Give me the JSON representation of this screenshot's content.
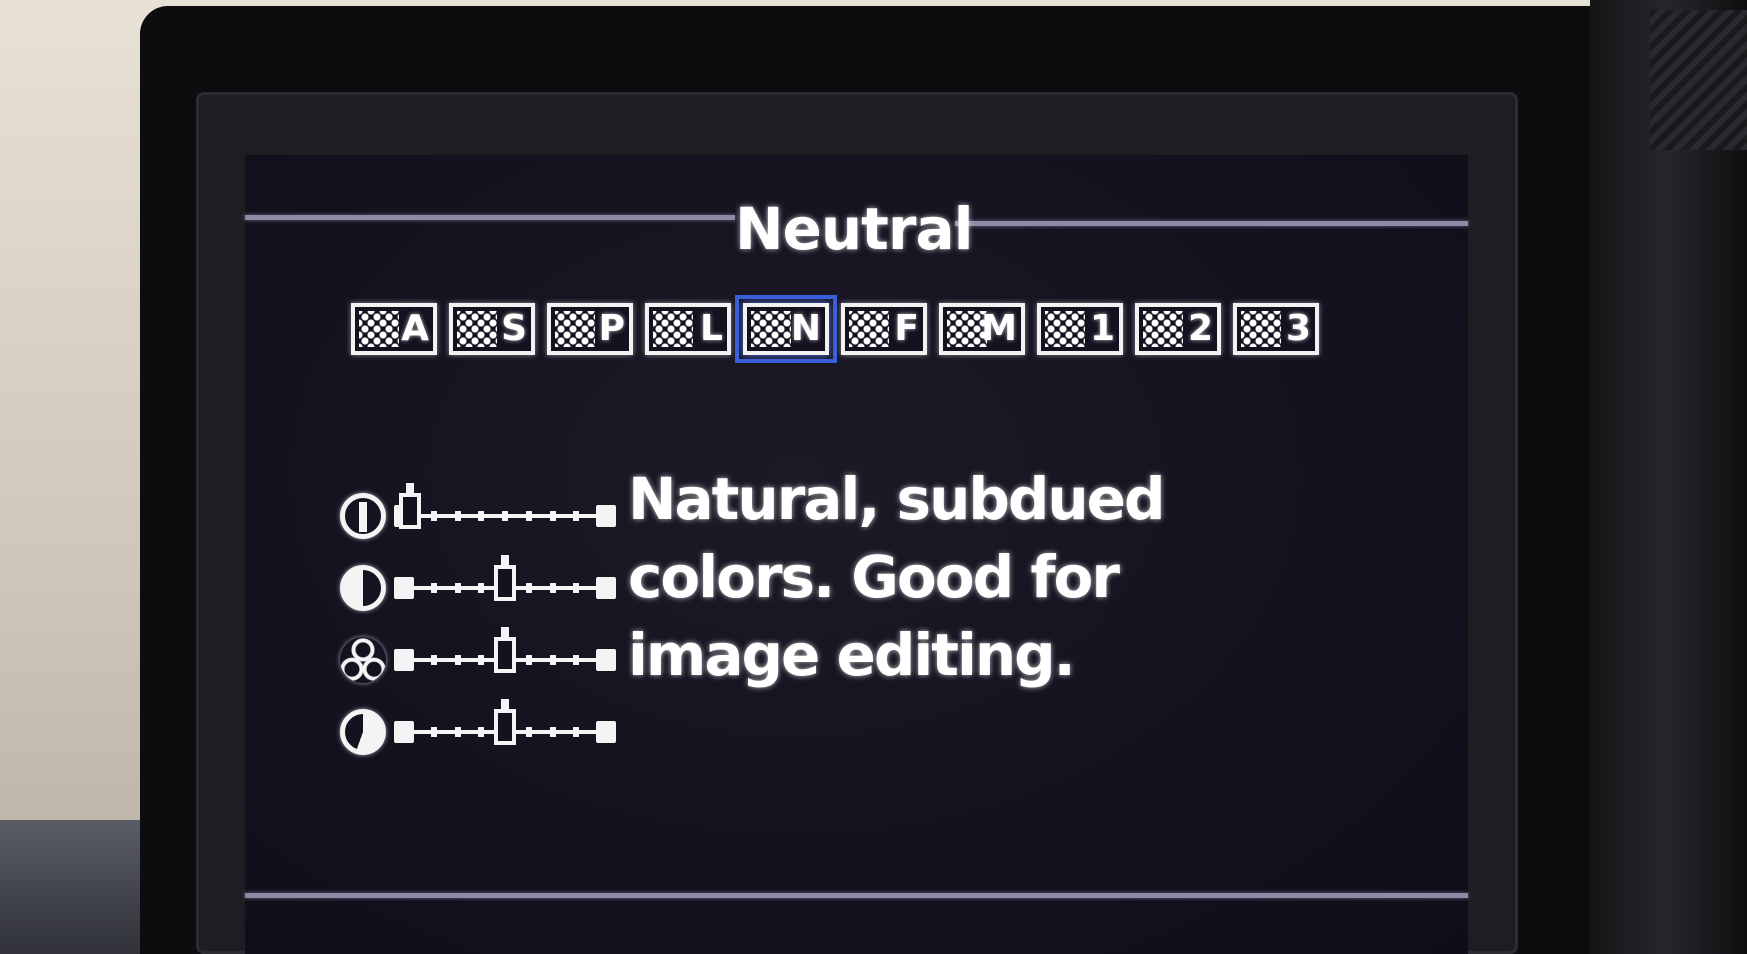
{
  "screen": {
    "title": "Neutral",
    "picture_styles": [
      {
        "code": "A",
        "selected": false
      },
      {
        "code": "S",
        "selected": false
      },
      {
        "code": "P",
        "selected": false
      },
      {
        "code": "L",
        "selected": false
      },
      {
        "code": "N",
        "selected": true
      },
      {
        "code": "F",
        "selected": false
      },
      {
        "code": "M",
        "selected": false
      },
      {
        "code": "1",
        "selected": false
      },
      {
        "code": "2",
        "selected": false
      },
      {
        "code": "3",
        "selected": false
      }
    ],
    "parameters": [
      {
        "icon": "sharpness-icon",
        "level": 0,
        "steps": 8
      },
      {
        "icon": "contrast-icon",
        "level": 4,
        "steps": 8
      },
      {
        "icon": "saturation-icon",
        "level": 4,
        "steps": 8
      },
      {
        "icon": "color-tone-icon",
        "level": 4,
        "steps": 8
      }
    ],
    "description_lines": [
      "Natural, subdued",
      "colors. Good for",
      "image editing."
    ]
  },
  "colors": {
    "screen_bg": "#151220",
    "text": "#ffffff",
    "selection": "#3b5fd6",
    "divider": "#8c8aa6"
  }
}
